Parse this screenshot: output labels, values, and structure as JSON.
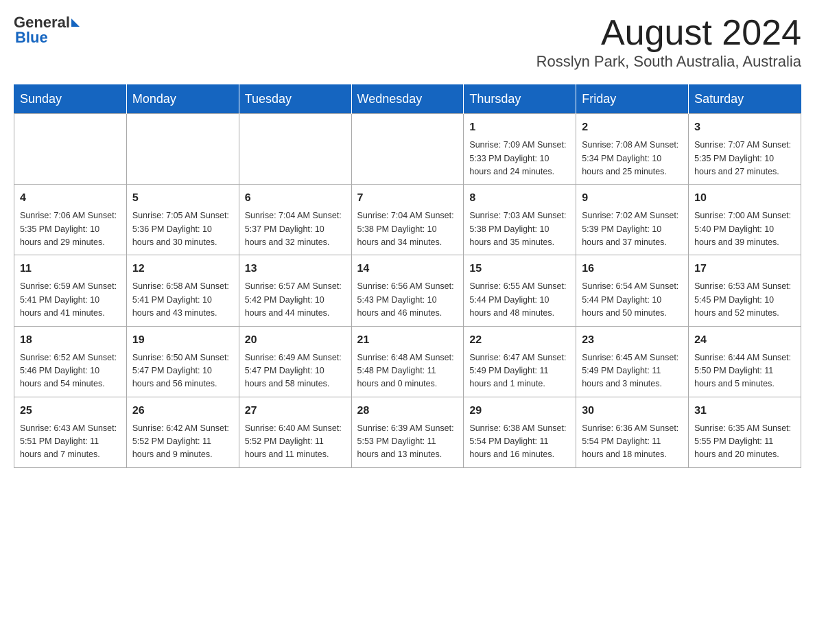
{
  "header": {
    "logo_text_general": "General",
    "logo_text_blue": "Blue",
    "title": "August 2024",
    "subtitle": "Rosslyn Park, South Australia, Australia"
  },
  "calendar": {
    "days_of_week": [
      "Sunday",
      "Monday",
      "Tuesday",
      "Wednesday",
      "Thursday",
      "Friday",
      "Saturday"
    ],
    "weeks": [
      [
        {
          "day": "",
          "info": ""
        },
        {
          "day": "",
          "info": ""
        },
        {
          "day": "",
          "info": ""
        },
        {
          "day": "",
          "info": ""
        },
        {
          "day": "1",
          "info": "Sunrise: 7:09 AM\nSunset: 5:33 PM\nDaylight: 10 hours and 24 minutes."
        },
        {
          "day": "2",
          "info": "Sunrise: 7:08 AM\nSunset: 5:34 PM\nDaylight: 10 hours and 25 minutes."
        },
        {
          "day": "3",
          "info": "Sunrise: 7:07 AM\nSunset: 5:35 PM\nDaylight: 10 hours and 27 minutes."
        }
      ],
      [
        {
          "day": "4",
          "info": "Sunrise: 7:06 AM\nSunset: 5:35 PM\nDaylight: 10 hours and 29 minutes."
        },
        {
          "day": "5",
          "info": "Sunrise: 7:05 AM\nSunset: 5:36 PM\nDaylight: 10 hours and 30 minutes."
        },
        {
          "day": "6",
          "info": "Sunrise: 7:04 AM\nSunset: 5:37 PM\nDaylight: 10 hours and 32 minutes."
        },
        {
          "day": "7",
          "info": "Sunrise: 7:04 AM\nSunset: 5:38 PM\nDaylight: 10 hours and 34 minutes."
        },
        {
          "day": "8",
          "info": "Sunrise: 7:03 AM\nSunset: 5:38 PM\nDaylight: 10 hours and 35 minutes."
        },
        {
          "day": "9",
          "info": "Sunrise: 7:02 AM\nSunset: 5:39 PM\nDaylight: 10 hours and 37 minutes."
        },
        {
          "day": "10",
          "info": "Sunrise: 7:00 AM\nSunset: 5:40 PM\nDaylight: 10 hours and 39 minutes."
        }
      ],
      [
        {
          "day": "11",
          "info": "Sunrise: 6:59 AM\nSunset: 5:41 PM\nDaylight: 10 hours and 41 minutes."
        },
        {
          "day": "12",
          "info": "Sunrise: 6:58 AM\nSunset: 5:41 PM\nDaylight: 10 hours and 43 minutes."
        },
        {
          "day": "13",
          "info": "Sunrise: 6:57 AM\nSunset: 5:42 PM\nDaylight: 10 hours and 44 minutes."
        },
        {
          "day": "14",
          "info": "Sunrise: 6:56 AM\nSunset: 5:43 PM\nDaylight: 10 hours and 46 minutes."
        },
        {
          "day": "15",
          "info": "Sunrise: 6:55 AM\nSunset: 5:44 PM\nDaylight: 10 hours and 48 minutes."
        },
        {
          "day": "16",
          "info": "Sunrise: 6:54 AM\nSunset: 5:44 PM\nDaylight: 10 hours and 50 minutes."
        },
        {
          "day": "17",
          "info": "Sunrise: 6:53 AM\nSunset: 5:45 PM\nDaylight: 10 hours and 52 minutes."
        }
      ],
      [
        {
          "day": "18",
          "info": "Sunrise: 6:52 AM\nSunset: 5:46 PM\nDaylight: 10 hours and 54 minutes."
        },
        {
          "day": "19",
          "info": "Sunrise: 6:50 AM\nSunset: 5:47 PM\nDaylight: 10 hours and 56 minutes."
        },
        {
          "day": "20",
          "info": "Sunrise: 6:49 AM\nSunset: 5:47 PM\nDaylight: 10 hours and 58 minutes."
        },
        {
          "day": "21",
          "info": "Sunrise: 6:48 AM\nSunset: 5:48 PM\nDaylight: 11 hours and 0 minutes."
        },
        {
          "day": "22",
          "info": "Sunrise: 6:47 AM\nSunset: 5:49 PM\nDaylight: 11 hours and 1 minute."
        },
        {
          "day": "23",
          "info": "Sunrise: 6:45 AM\nSunset: 5:49 PM\nDaylight: 11 hours and 3 minutes."
        },
        {
          "day": "24",
          "info": "Sunrise: 6:44 AM\nSunset: 5:50 PM\nDaylight: 11 hours and 5 minutes."
        }
      ],
      [
        {
          "day": "25",
          "info": "Sunrise: 6:43 AM\nSunset: 5:51 PM\nDaylight: 11 hours and 7 minutes."
        },
        {
          "day": "26",
          "info": "Sunrise: 6:42 AM\nSunset: 5:52 PM\nDaylight: 11 hours and 9 minutes."
        },
        {
          "day": "27",
          "info": "Sunrise: 6:40 AM\nSunset: 5:52 PM\nDaylight: 11 hours and 11 minutes."
        },
        {
          "day": "28",
          "info": "Sunrise: 6:39 AM\nSunset: 5:53 PM\nDaylight: 11 hours and 13 minutes."
        },
        {
          "day": "29",
          "info": "Sunrise: 6:38 AM\nSunset: 5:54 PM\nDaylight: 11 hours and 16 minutes."
        },
        {
          "day": "30",
          "info": "Sunrise: 6:36 AM\nSunset: 5:54 PM\nDaylight: 11 hours and 18 minutes."
        },
        {
          "day": "31",
          "info": "Sunrise: 6:35 AM\nSunset: 5:55 PM\nDaylight: 11 hours and 20 minutes."
        }
      ]
    ]
  }
}
